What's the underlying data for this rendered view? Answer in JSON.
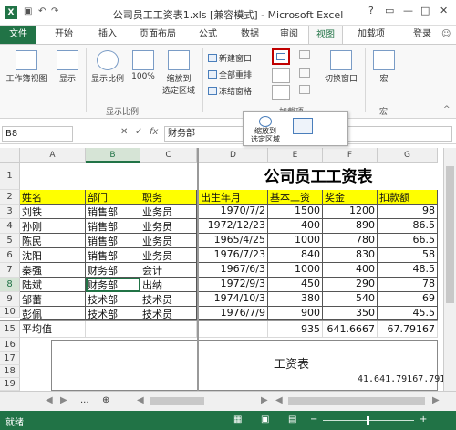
{
  "title_bar": {
    "app_badge": "X",
    "title": "公司员工工资表1.xls  [兼容模式] - Microsoft Excel",
    "undo": "↶",
    "redo": "↷",
    "controls": [
      "?",
      "▭",
      "—",
      "□",
      "✕"
    ]
  },
  "ribbon": {
    "file_tab": "文件",
    "tabs": [
      "开始",
      "插入",
      "页面布局",
      "公式",
      "数据",
      "审阅",
      "视图",
      "加载项"
    ],
    "active_tab": "视图",
    "login": "登录",
    "buttons": {
      "workbook_views": "工作簿视图",
      "show": "显示",
      "zoom": "显示比例",
      "zoom100": "100%",
      "zoom_selection_line1": "缩放到",
      "zoom_selection_line2": "选定区域",
      "new_window": "新建窗口",
      "arrange_all": "全部重排",
      "freeze_panes": "冻结窗格",
      "switch_windows": "切换窗口",
      "macros": "宏"
    },
    "groups": {
      "zoom": "显示比例",
      "macros": "宏"
    },
    "addins_label": "加载项"
  },
  "formula_bar": {
    "name_box": "B8",
    "cancel": "✕",
    "enter": "✓",
    "fx": "fx",
    "value": "财务部"
  },
  "tooltip_popup": {
    "zoom_selection_line1": "缩放到",
    "zoom_selection_line2": "选定区域"
  },
  "sheet": {
    "columns": [
      "A",
      "B",
      "C",
      "D",
      "E",
      "F",
      "G"
    ],
    "row_numbers": [
      "1",
      "2",
      "3",
      "4",
      "5",
      "6",
      "7",
      "8",
      "9",
      "10",
      "15",
      "16",
      "17",
      "18",
      "19"
    ],
    "title": "公司员工工资表",
    "headers": [
      "姓名",
      "部门",
      "职务",
      "出生年月",
      "基本工资",
      "奖金",
      "扣款额"
    ],
    "rows": [
      [
        "刘铁",
        "销售部",
        "业务员",
        "1970/7/2",
        "1500",
        "1200",
        "98"
      ],
      [
        "孙刚",
        "销售部",
        "业务员",
        "1972/12/23",
        "400",
        "890",
        "86.5"
      ],
      [
        "陈民",
        "销售部",
        "业务员",
        "1965/4/25",
        "1000",
        "780",
        "66.5"
      ],
      [
        "沈阳",
        "销售部",
        "业务员",
        "1976/7/23",
        "840",
        "830",
        "58"
      ],
      [
        "秦强",
        "财务部",
        "会计",
        "1967/6/3",
        "1000",
        "400",
        "48.5"
      ],
      [
        "陆斌",
        "财务部",
        "出纳",
        "1972/9/3",
        "450",
        "290",
        "78"
      ],
      [
        "邹蕾",
        "技术部",
        "技术员",
        "1974/10/3",
        "380",
        "540",
        "69"
      ],
      [
        "彭佩",
        "技术部",
        "技术员",
        "1976/7/9",
        "900",
        "350",
        "45.5"
      ]
    ],
    "average_row": {
      "label": "平均值",
      "e": "935",
      "f": "641.6667",
      "g": "67.79167"
    },
    "lower_title": "工资表",
    "lower_values": "41.641.79167.791"
  },
  "sheet_tabs": {
    "prev": "◀",
    "next": "▶",
    "more": "...",
    "add": "⊕"
  },
  "status_bar": {
    "ready": "就绪"
  },
  "colors": {
    "excel_green": "#217346",
    "header_yellow": "#ffff00"
  }
}
